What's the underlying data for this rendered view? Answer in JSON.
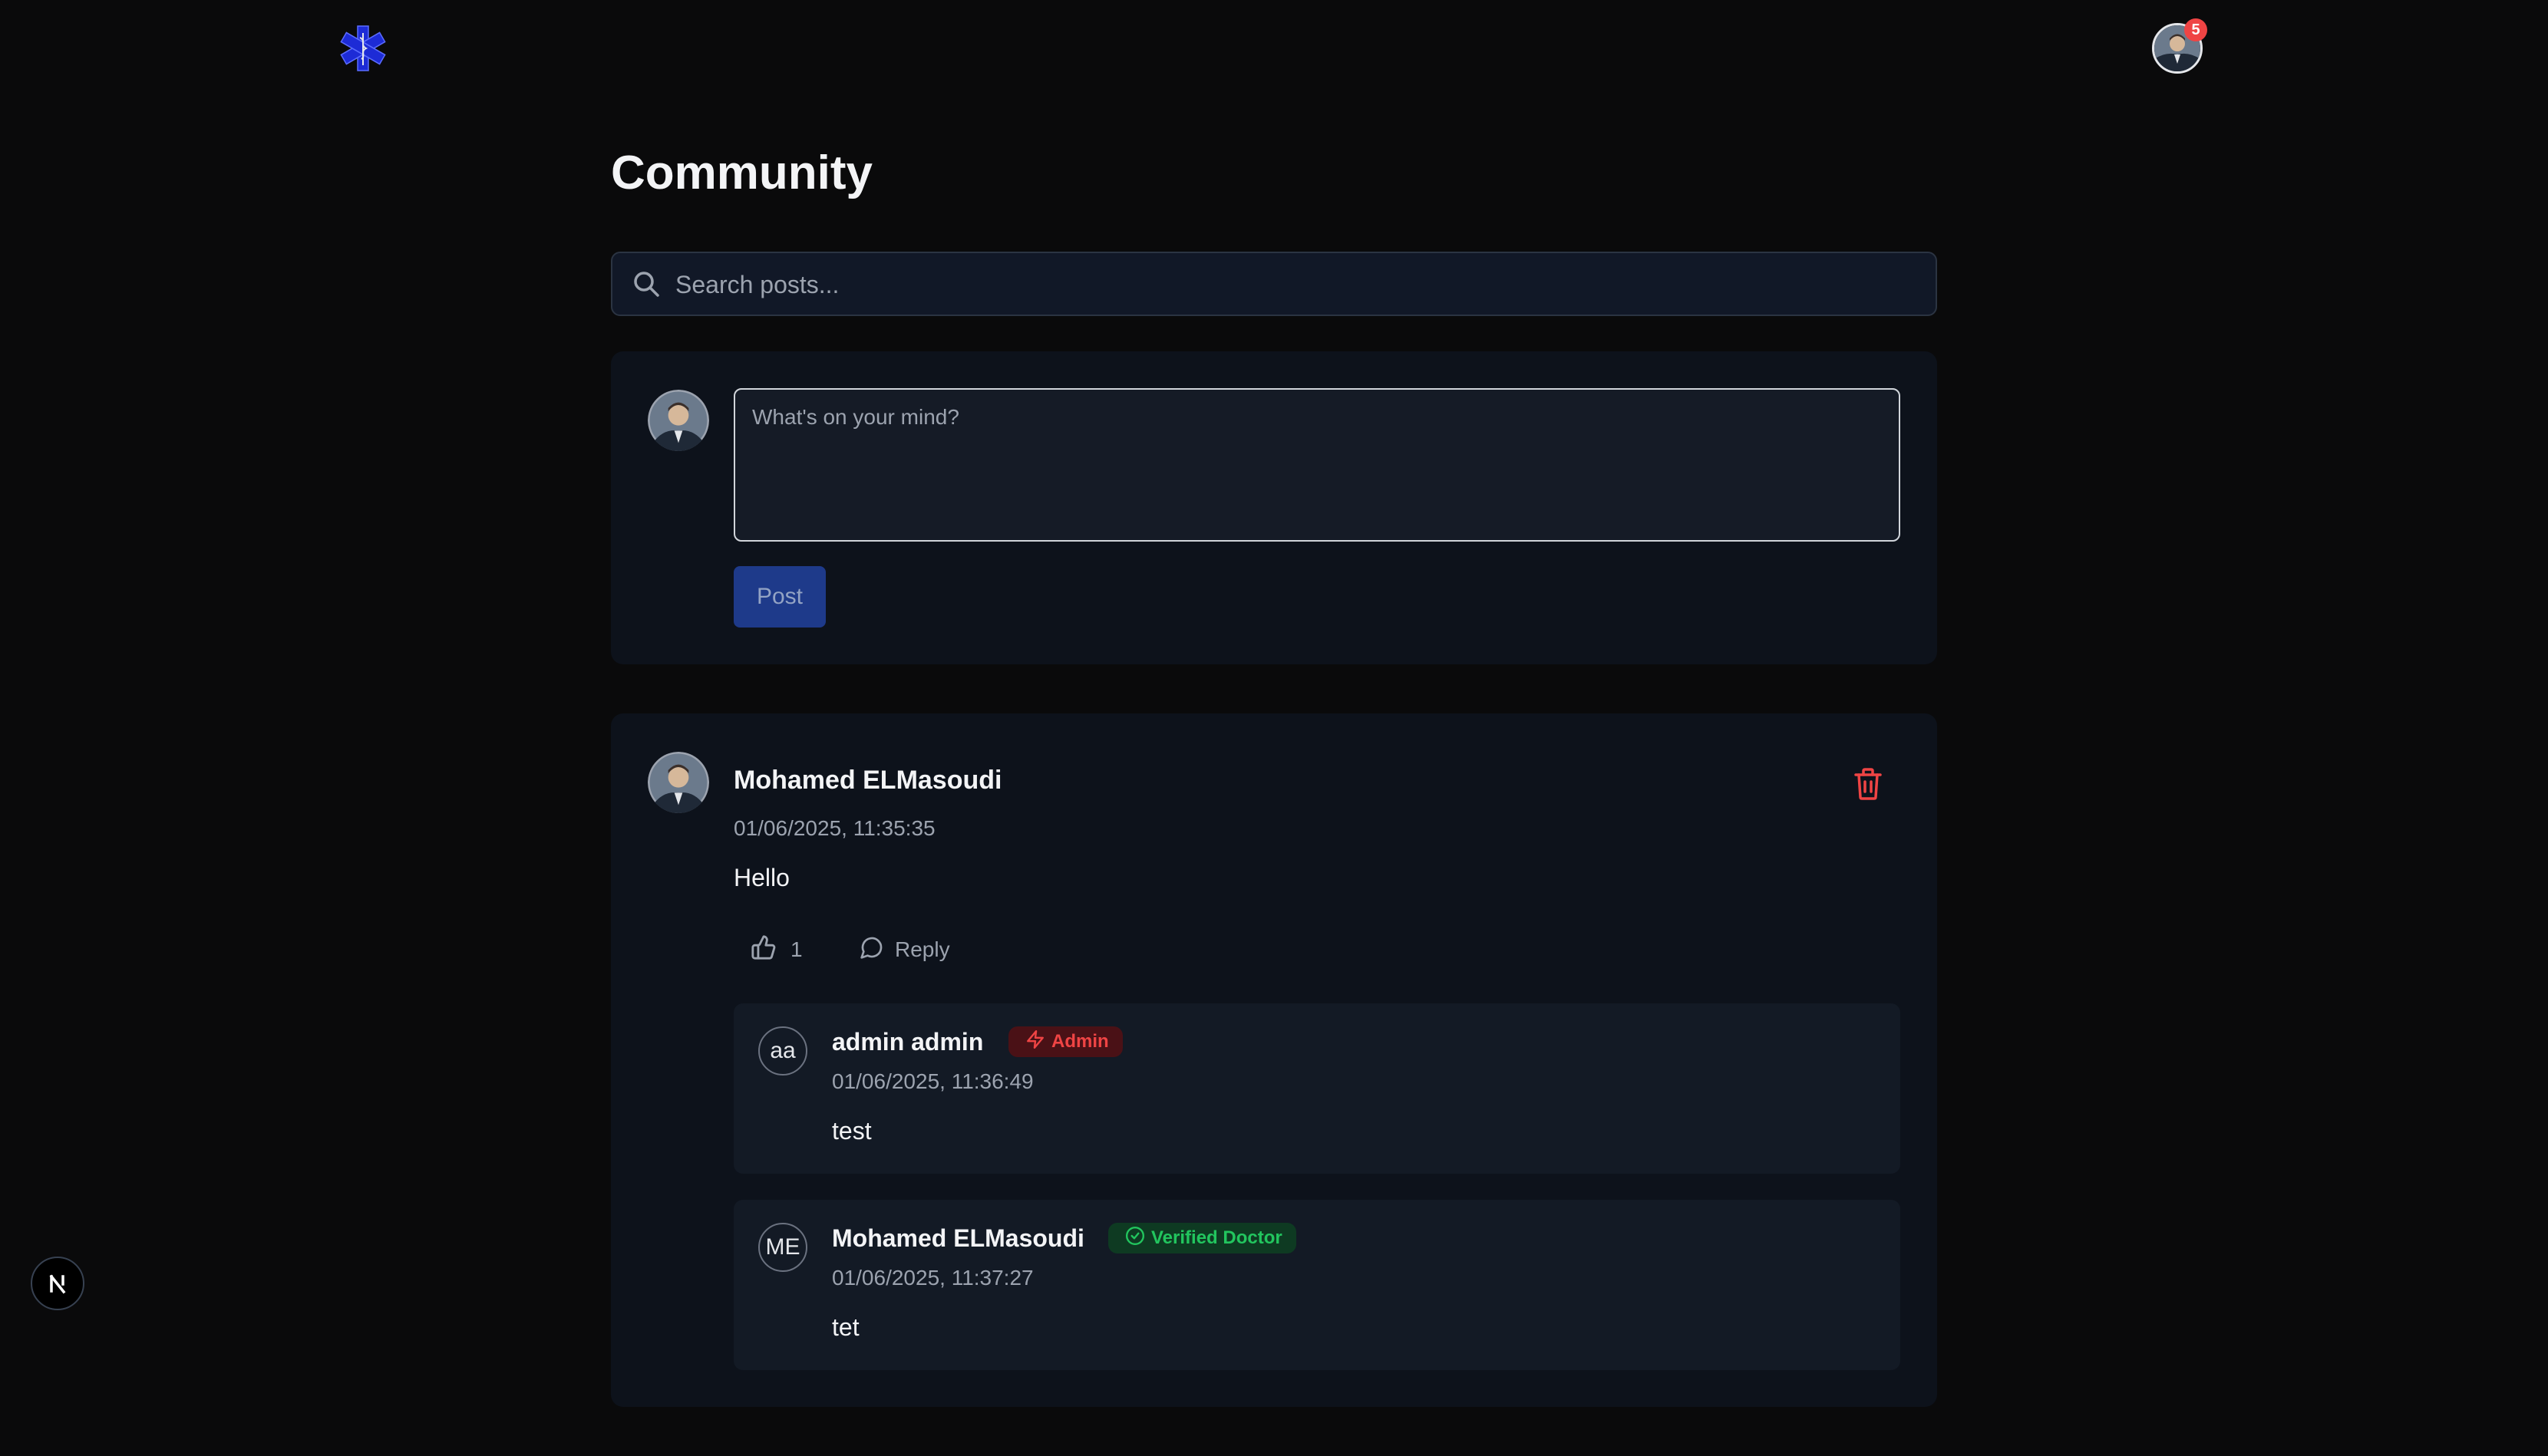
{
  "header": {
    "logo_icon": "star-of-life-icon",
    "notifications_count": "5"
  },
  "page": {
    "title": "Community"
  },
  "search": {
    "placeholder": "Search posts..."
  },
  "composer": {
    "placeholder": "What's on your mind?",
    "post_label": "Post"
  },
  "post": {
    "author": "Mohamed ELMasoudi",
    "timestamp": "01/06/2025, 11:35:35",
    "body": "Hello",
    "likes": "1",
    "reply_label": "Reply"
  },
  "replies": [
    {
      "initials": "aa",
      "name": "admin admin",
      "badge": "Admin",
      "badge_color": "#ef4444",
      "timestamp": "01/06/2025, 11:36:49",
      "body": "test"
    },
    {
      "initials": "ME",
      "name": "Mohamed ELMasoudi",
      "badge": "Verified Doctor",
      "badge_color": "#22c55e",
      "timestamp": "01/06/2025, 11:37:27",
      "body": "tet"
    }
  ],
  "colors": {
    "background": "#0a0a0b",
    "card": "#0d121b",
    "primary_button": "#1e3a8a",
    "danger": "#ef4444"
  }
}
